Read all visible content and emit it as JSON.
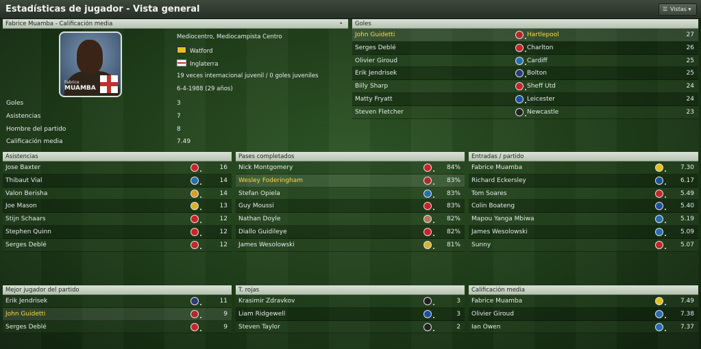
{
  "window": {
    "title": "Estadísticas de jugador - Vista general",
    "views_button": "Vistas"
  },
  "profile": {
    "header": "Fabrice Muamba - Calificación media",
    "photo_first_name": "Fabrice",
    "photo_last_name": "MUAMBA",
    "position": "Mediocentro, Mediocampista Centro",
    "club": "Watford",
    "nation": "Inglaterra",
    "caps": "19 veces internacional juvenil / 0 goles juveniles",
    "dob": "6-4-1988 (29 años)",
    "stats": [
      {
        "label": "Goles",
        "value": "3"
      },
      {
        "label": "Asistencias",
        "value": "7"
      },
      {
        "label": "Hombre del partido",
        "value": "8"
      },
      {
        "label": "Calificación media",
        "value": "7.49"
      }
    ]
  },
  "goals": {
    "header": "Goles",
    "rows": [
      {
        "name": "John Guidetti",
        "club": "Hartlepool",
        "value": "27",
        "highlight": true,
        "color": "#b02a2a"
      },
      {
        "name": "Serges Deblé",
        "club": "Charlton",
        "value": "26",
        "highlight": false,
        "color": "#c8242b"
      },
      {
        "name": "Olivier Giroud",
        "club": "Cardiff",
        "value": "25",
        "highlight": false,
        "color": "#2a6cb2"
      },
      {
        "name": "Erik Jendrisek",
        "club": "Bolton",
        "value": "25",
        "highlight": false,
        "color": "#2a3a7a"
      },
      {
        "name": "Billy Sharp",
        "club": "Sheff Utd",
        "value": "24",
        "highlight": false,
        "color": "#c8242b"
      },
      {
        "name": "Matty Fryatt",
        "club": "Leicester",
        "value": "24",
        "highlight": false,
        "color": "#1e4fa0"
      },
      {
        "name": "Steven Fletcher",
        "club": "Newcastle",
        "value": "23",
        "highlight": false,
        "color": "#222222"
      }
    ]
  },
  "assists": {
    "header": "Asistencias",
    "rows": [
      {
        "name": "Jose Baxter",
        "value": "16",
        "color": "#c8242b"
      },
      {
        "name": "Thibaut Vial",
        "value": "14",
        "color": "#2a6cb2"
      },
      {
        "name": "Valon Berisha",
        "value": "14",
        "color": "#d79a2a"
      },
      {
        "name": "Joe Mason",
        "value": "13",
        "color": "#d7b22a"
      },
      {
        "name": "Stijn Schaars",
        "value": "12",
        "color": "#c8242b"
      },
      {
        "name": "Stephen Quinn",
        "value": "12",
        "color": "#c8242b"
      },
      {
        "name": "Serges Deblé",
        "value": "12",
        "color": "#c8242b"
      }
    ]
  },
  "passes": {
    "header": "Pases completados",
    "rows": [
      {
        "name": "Nick Montgomery",
        "value": "84%",
        "highlight": false,
        "color": "#c8242b"
      },
      {
        "name": "Wesley Foderingham",
        "value": "83%",
        "highlight": true,
        "color": "#b02a2a"
      },
      {
        "name": "Stefan Opiela",
        "value": "83%",
        "highlight": false,
        "color": "#2a6cb2"
      },
      {
        "name": "Guy Moussi",
        "value": "83%",
        "highlight": false,
        "color": "#c8242b"
      },
      {
        "name": "Nathan Doyle",
        "value": "82%",
        "highlight": false,
        "color": "#b07a5a"
      },
      {
        "name": "Diallo Guidileye",
        "value": "82%",
        "highlight": false,
        "color": "#c8242b"
      },
      {
        "name": "James Wesolowski",
        "value": "81%",
        "highlight": false,
        "color": "#d7b22a"
      }
    ]
  },
  "tackles": {
    "header": "Entradas / partido",
    "rows": [
      {
        "name": "Fabrice Muamba",
        "value": "7.30",
        "color": "#e4c21e"
      },
      {
        "name": "Richard Eckersley",
        "value": "6.17",
        "color": "#1e4fa0"
      },
      {
        "name": "Tom Soares",
        "value": "5.49",
        "color": "#c8242b"
      },
      {
        "name": "Colin Boateng",
        "value": "5.40",
        "color": "#1e4fa0"
      },
      {
        "name": "Mapou Yanga Mbiwa",
        "value": "5.19",
        "color": "#2a6cb2"
      },
      {
        "name": "James Wesolowski",
        "value": "5.09",
        "color": "#2a6cb2"
      },
      {
        "name": "Sunny",
        "value": "5.07",
        "color": "#c8242b"
      }
    ]
  },
  "motm": {
    "header": "Mejor jugador del partido",
    "rows": [
      {
        "name": "Erik Jendrisek",
        "value": "11",
        "highlight": false,
        "color": "#2a3a7a"
      },
      {
        "name": "John Guidetti",
        "value": "9",
        "highlight": true,
        "color": "#b02a2a"
      },
      {
        "name": "Serges Deblé",
        "value": "9",
        "highlight": false,
        "color": "#c8242b"
      }
    ]
  },
  "reds": {
    "header": "T. rojas",
    "rows": [
      {
        "name": "Krasimir Zdravkov",
        "value": "3",
        "color": "#222222"
      },
      {
        "name": "Liam Ridgewell",
        "value": "3",
        "color": "#1e4fa0"
      },
      {
        "name": "Steven Taylor",
        "value": "2",
        "color": "#222222"
      }
    ]
  },
  "rating": {
    "header": "Calificación media",
    "rows": [
      {
        "name": "Fabrice Muamba",
        "value": "7.49",
        "color": "#e4c21e"
      },
      {
        "name": "Olivier Giroud",
        "value": "7.38",
        "color": "#2a6cb2"
      },
      {
        "name": "Ian Owen",
        "value": "7.37",
        "color": "#2a6cb2"
      }
    ]
  }
}
